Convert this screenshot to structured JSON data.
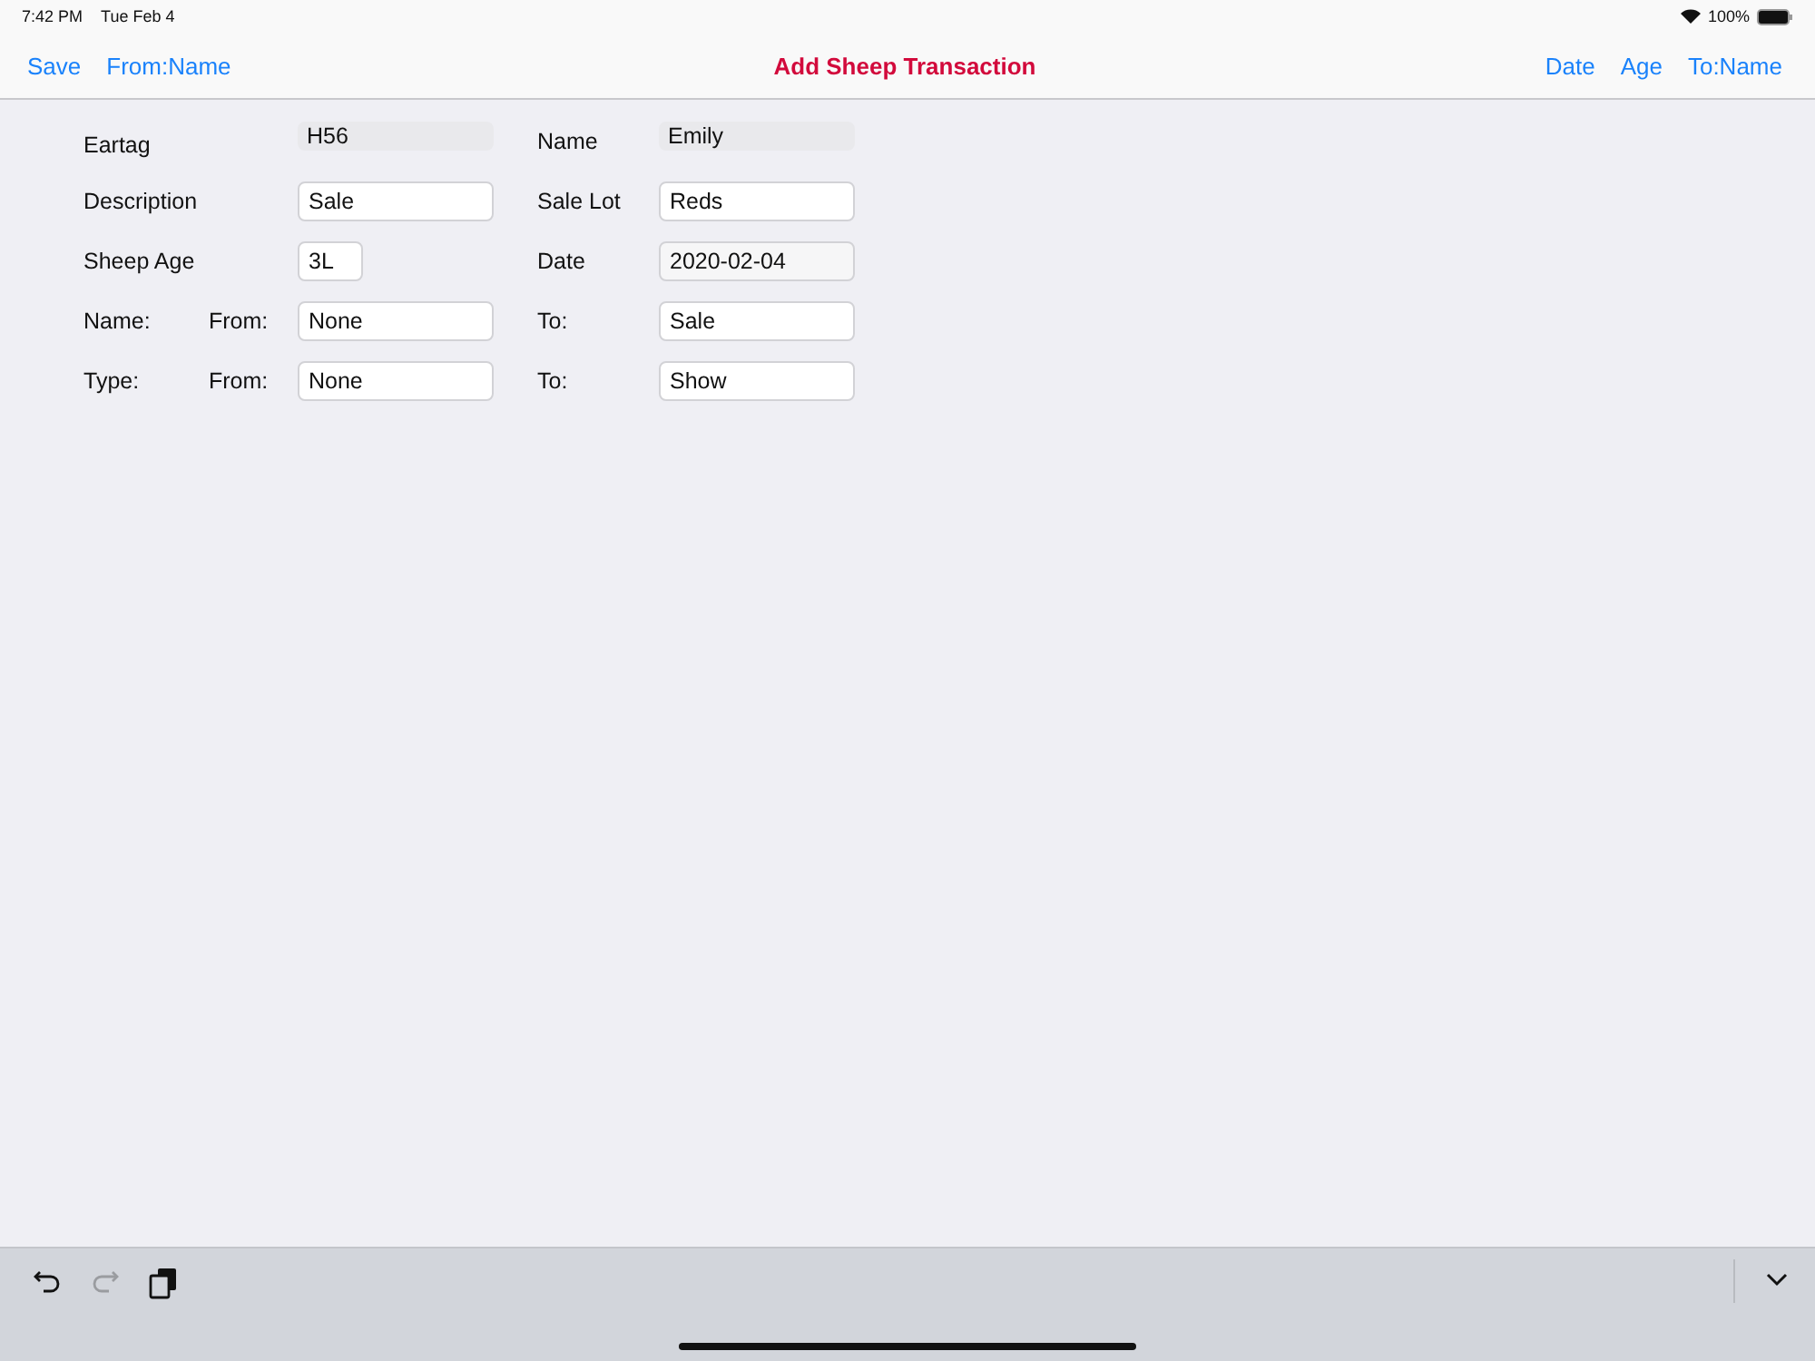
{
  "status_bar": {
    "time": "7:42 PM",
    "date": "Tue Feb 4",
    "battery": "100%"
  },
  "nav": {
    "left": [
      "Save",
      "From:Name"
    ],
    "title": "Add Sheep Transaction",
    "right": [
      "Date",
      "Age",
      "To:Name"
    ]
  },
  "rows": [
    {
      "label": "Eartag",
      "field": {
        "value": "H56",
        "kind": "readonly"
      },
      "label2": "Name",
      "field2": {
        "value": "Emily",
        "kind": "readonly"
      }
    },
    {
      "label": "Description",
      "field": {
        "value": "Sale",
        "kind": "text"
      },
      "label2": "Sale Lot",
      "field2": {
        "value": "Reds",
        "kind": "text"
      }
    },
    {
      "label": "Sheep Age",
      "field": {
        "value": "3L",
        "kind": "short"
      },
      "label2": "Date",
      "field2": {
        "value": "2020-02-04",
        "kind": "locked"
      }
    },
    {
      "label": "Name:",
      "sublabel": "From:",
      "field": {
        "value": "None",
        "kind": "text"
      },
      "label2": "To:",
      "field2": {
        "value": "Sale",
        "kind": "text"
      }
    },
    {
      "label": "Type:",
      "sublabel": "From:",
      "field": {
        "value": "None",
        "kind": "text"
      },
      "label2": "To:",
      "field2": {
        "value": "Show",
        "kind": "text"
      }
    }
  ],
  "toolbar": {
    "undo": {
      "disabled": false
    },
    "redo": {
      "disabled": true
    }
  }
}
